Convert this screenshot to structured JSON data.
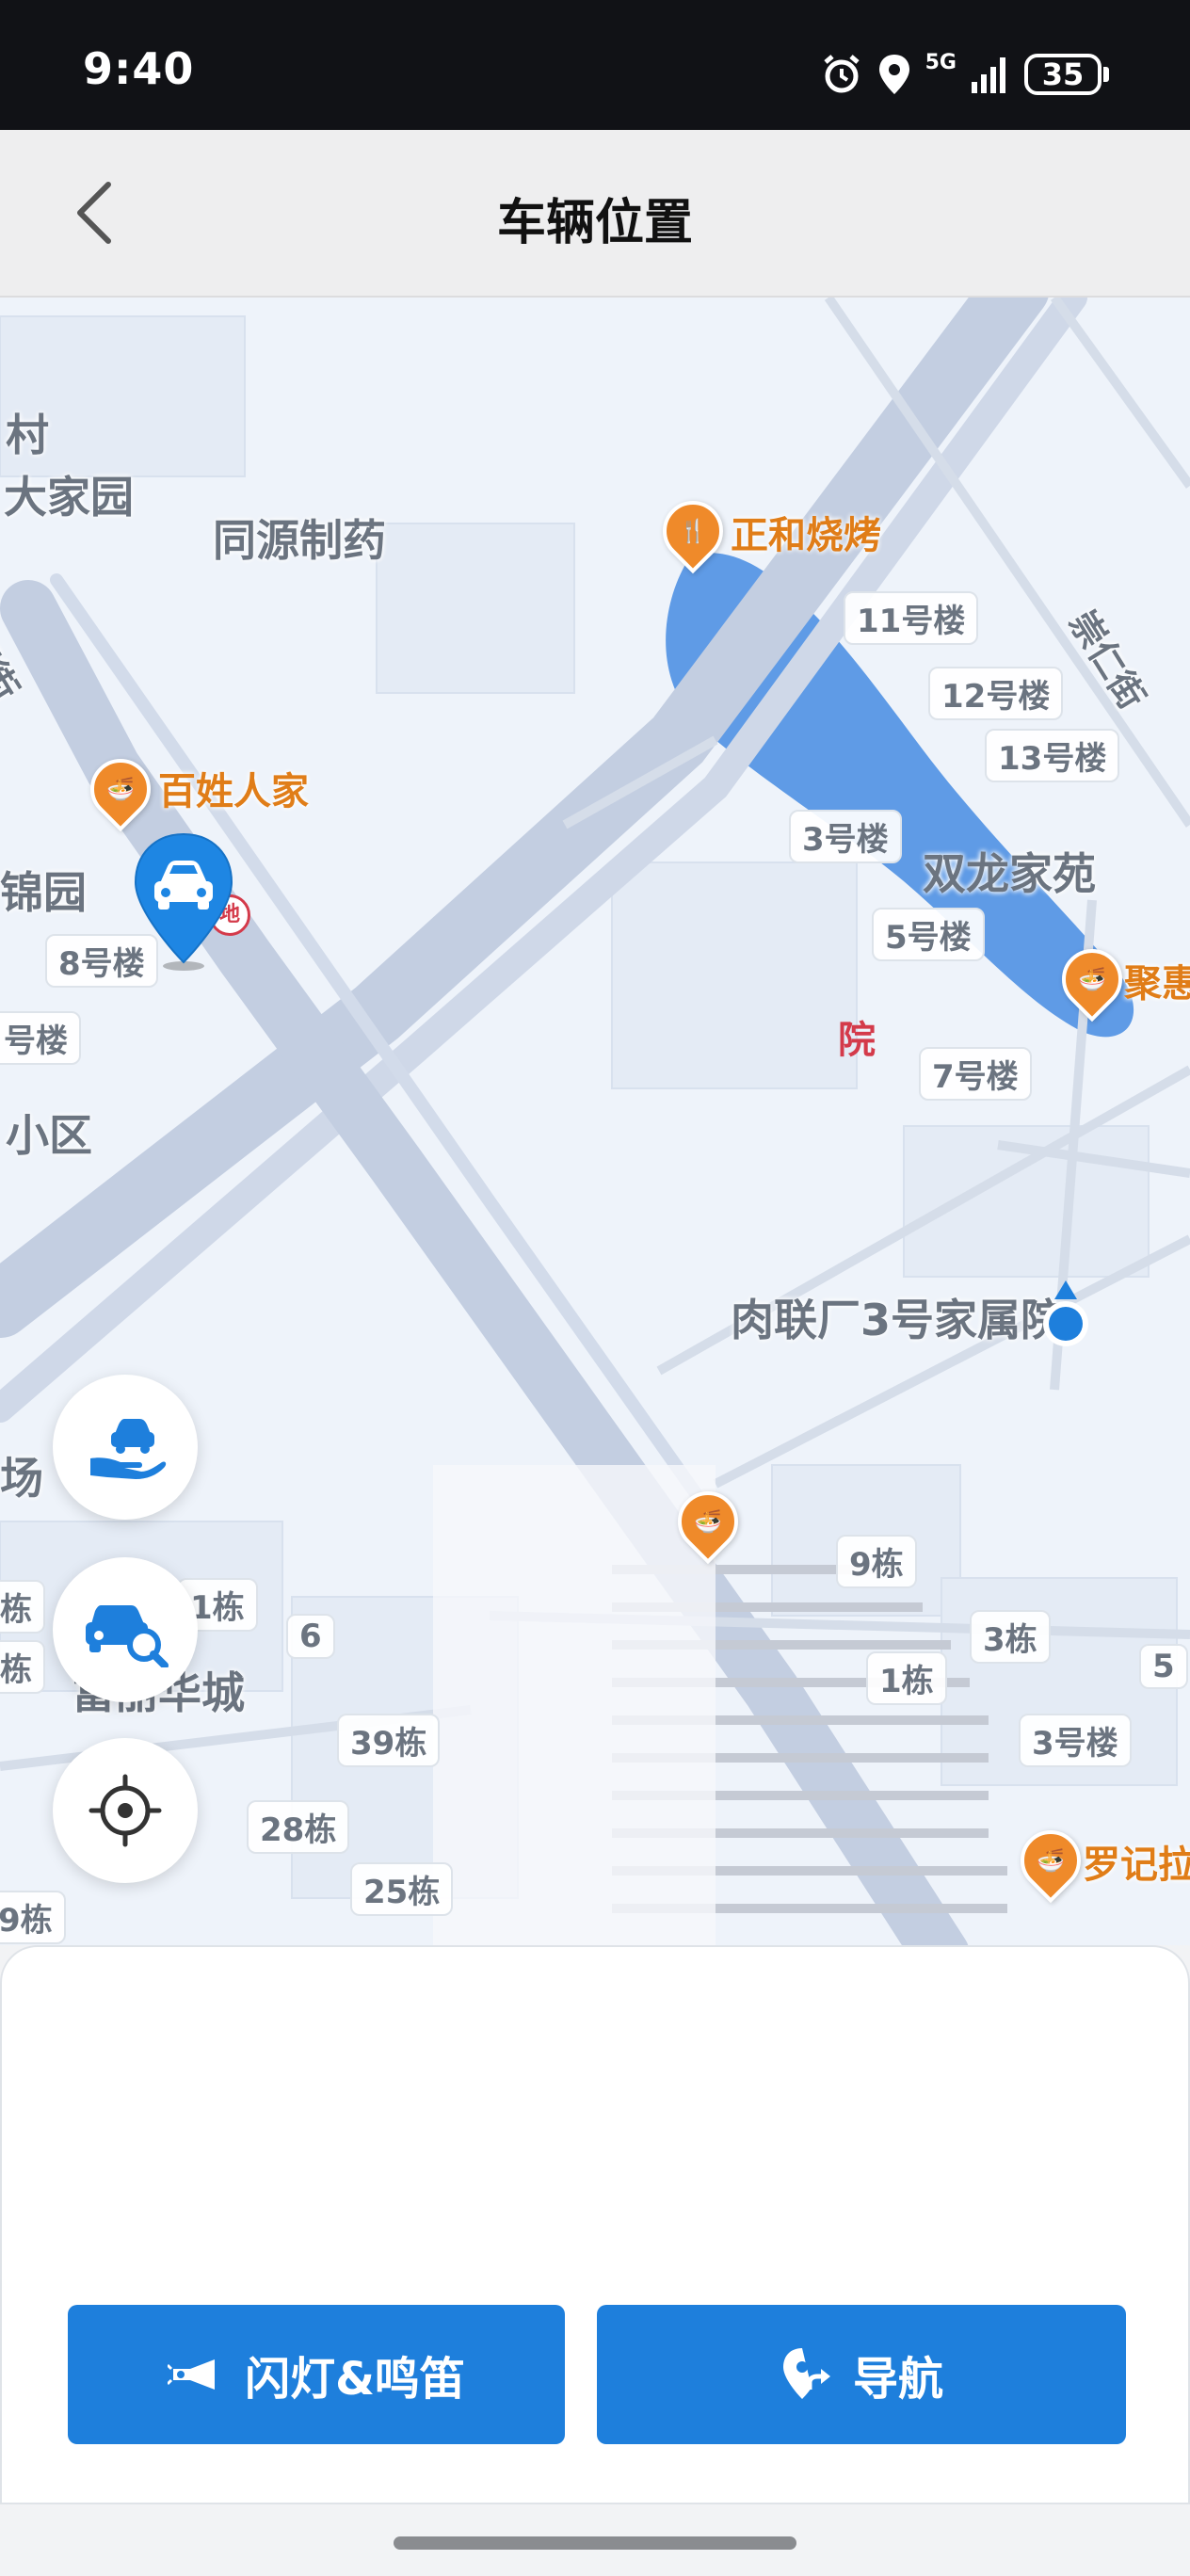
{
  "status_bar": {
    "time": "9:40",
    "network": "5G",
    "battery": "35",
    "icons": [
      "alarm-icon",
      "location-icon",
      "signal-icon",
      "battery-icon"
    ]
  },
  "header": {
    "title": "车辆位置",
    "back_icon": "chevron-left-icon"
  },
  "map": {
    "area_labels": [
      "村",
      "大家园",
      "同源制药",
      "锦园",
      "小区",
      "双龙家苑",
      "肉联厂3号家属院",
      "场",
      "富丽华城"
    ],
    "street_labels": [
      "区街",
      "崇仁街"
    ],
    "building_labels": [
      "11号楼",
      "12号楼",
      "13号楼",
      "3号楼",
      "5号楼",
      "7号楼",
      "8号楼",
      "号楼",
      "9栋",
      "3栋",
      "1栋",
      "5",
      "3号楼",
      "1栋",
      "6",
      "39栋",
      "28栋",
      "25栋",
      "9栋",
      "栋",
      "栋"
    ],
    "pois": [
      {
        "name": "正和烧烤",
        "icon": "restaurant-icon"
      },
      {
        "name": "百姓人家",
        "icon": "restaurant-icon"
      },
      {
        "name": "聚惠",
        "icon": "restaurant-icon"
      },
      {
        "name": "罗记拉",
        "icon": "restaurant-icon"
      },
      {
        "name": "",
        "icon": "restaurant-icon"
      }
    ],
    "red_label": "院",
    "metro_icon_text": "地"
  },
  "controls": [
    {
      "name": "hand-car-icon"
    },
    {
      "name": "car-search-icon"
    },
    {
      "name": "locate-target-icon"
    }
  ],
  "actions": {
    "flash_horn_label": "闪灯&鸣笛",
    "navigate_label": "导航"
  },
  "colors": {
    "primary": "#1E7FDC",
    "poi": "#EF8A2A",
    "water": "#5F9BE6",
    "road": "#C5D0E3"
  }
}
